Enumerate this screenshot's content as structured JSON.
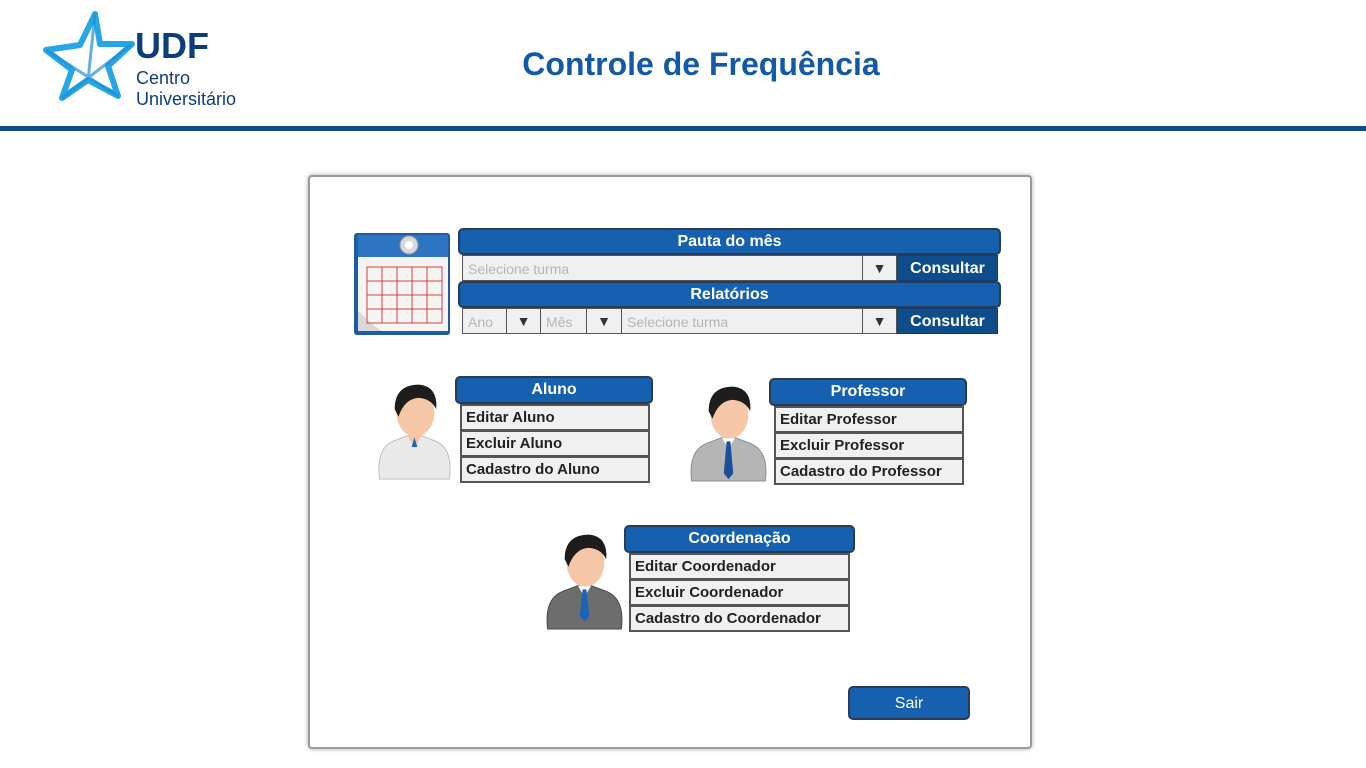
{
  "header": {
    "logo": {
      "brand": "UDF",
      "line1": "Centro",
      "line2": "Universitário"
    },
    "title": "Controle de Frequência"
  },
  "pauta": {
    "title": "Pauta do mês",
    "turma_placeholder": "Selecione turma",
    "consultar_label": "Consultar"
  },
  "relatorios": {
    "title": "Relatórios",
    "ano_placeholder": "Ano",
    "mes_placeholder": "Mês",
    "turma_placeholder": "Selecione turma",
    "consultar_label": "Consultar"
  },
  "icons": {
    "dropdown": "▼"
  },
  "aluno": {
    "title": "Aluno",
    "items": [
      "Editar Aluno",
      "Excluir Aluno",
      "Cadastro do Aluno"
    ]
  },
  "professor": {
    "title": "Professor",
    "items": [
      "Editar Professor",
      "Excluir Professor",
      "Cadastro do Professor"
    ]
  },
  "coordenacao": {
    "title": "Coordenação",
    "items": [
      "Editar Coordenador",
      "Excluir Coordenador",
      "Cadastro do Coordenador"
    ]
  },
  "sair_label": "Sair",
  "colors": {
    "primary": "#1660b0",
    "dark": "#0f4c8a",
    "title": "#125aa7"
  }
}
